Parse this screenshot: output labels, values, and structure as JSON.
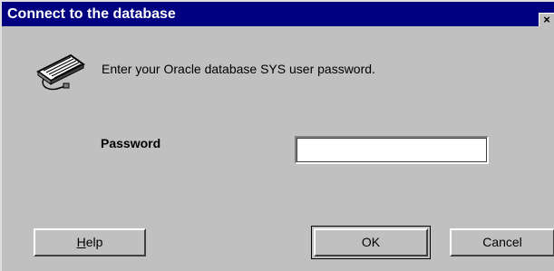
{
  "window": {
    "title": "Connect to the database",
    "close_glyph": "×"
  },
  "icons": {
    "keyboard": "keyboard-icon",
    "close": "close-icon"
  },
  "content": {
    "prompt": "Enter your Oracle database SYS user password.",
    "password_label": "Password",
    "password_value": ""
  },
  "buttons": {
    "help_first": "H",
    "help_rest": "elp",
    "ok": "OK",
    "cancel": "Cancel"
  },
  "colors": {
    "titlebar": "#000080",
    "dialog_bg": "#c0c0c0",
    "title_text": "#ffffff"
  }
}
